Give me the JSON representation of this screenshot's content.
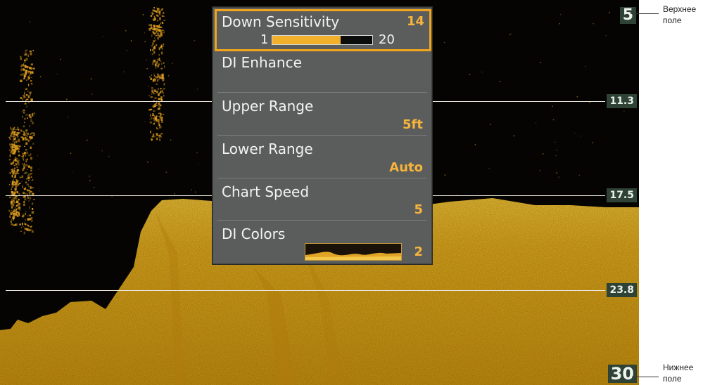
{
  "display": {
    "depth_top": "5",
    "depth_bottom": "30",
    "depth_marks": [
      "11.3",
      "17.5",
      "23.8"
    ]
  },
  "menu": {
    "sensitivity": {
      "label": "Down Sensitivity",
      "value": "14",
      "min": "1",
      "max": "20",
      "level": 0.68
    },
    "items": [
      {
        "label": "DI Enhance",
        "value": ""
      },
      {
        "label": "Upper Range",
        "value": "5ft"
      },
      {
        "label": "Lower Range",
        "value": "Auto"
      },
      {
        "label": "Chart Speed",
        "value": "5"
      },
      {
        "label": "DI Colors",
        "value": "2"
      }
    ]
  },
  "annotations": {
    "upper_field": [
      "Верхнее",
      "поле"
    ],
    "lower_field": [
      "Нижнее",
      "поле"
    ]
  },
  "colors": {
    "menu_bg": "#5b5d5c",
    "accent": "#f0a51c",
    "sonar_yellow": "#e8b020",
    "depth_tag_bg": "#2f4236"
  }
}
